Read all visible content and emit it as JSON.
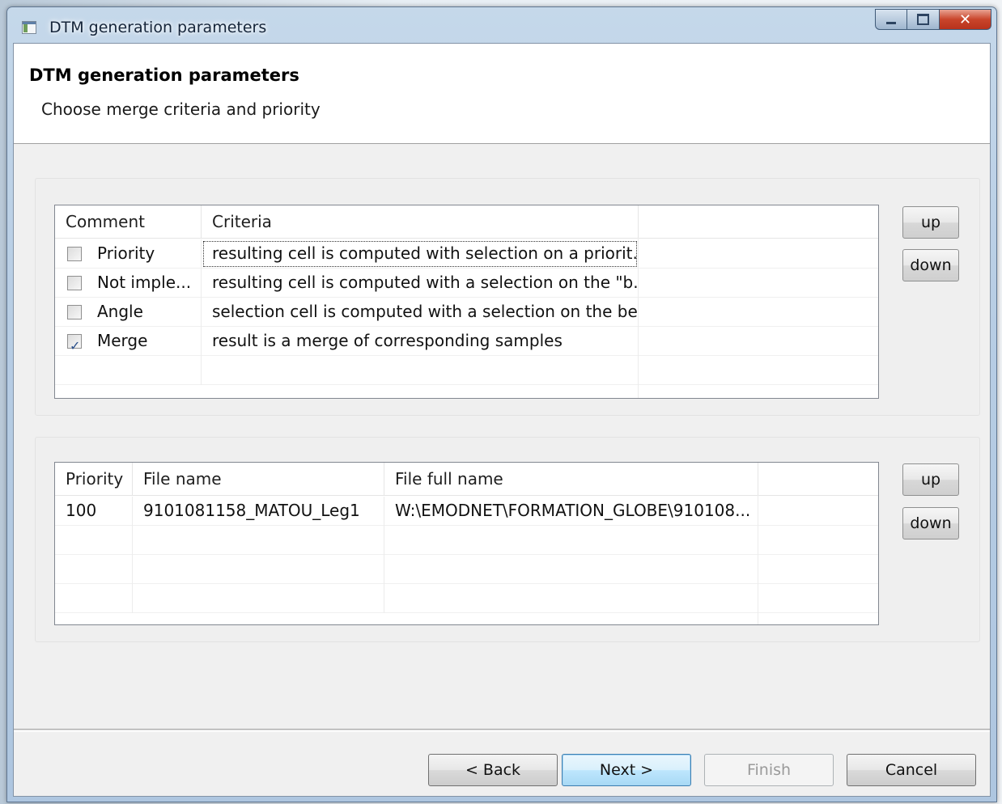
{
  "window": {
    "title": "DTM generation parameters"
  },
  "header": {
    "title": "DTM generation parameters",
    "subtitle": "Choose merge criteria and priority"
  },
  "criteria_table": {
    "columns": [
      "Comment",
      "Criteria",
      ""
    ],
    "rows": [
      {
        "checked": false,
        "comment": "Priority",
        "criteria": "resulting cell is computed with selection on a priorit..."
      },
      {
        "checked": false,
        "comment": "Not imple...",
        "criteria": "resulting cell is computed with a selection on the \"b..."
      },
      {
        "checked": false,
        "comment": "Angle",
        "criteria": "selection cell is computed with a selection on the be..."
      },
      {
        "checked": true,
        "comment": "Merge",
        "criteria": "result is a merge of corresponding samples"
      }
    ],
    "up_label": "up",
    "down_label": "down"
  },
  "files_table": {
    "columns": [
      "Priority",
      "File name",
      "File full name",
      ""
    ],
    "rows": [
      {
        "priority": "100",
        "file_name": "9101081158_MATOU_Leg1",
        "file_full_name": "W:\\EMODNET\\FORMATION_GLOBE\\910108..."
      }
    ],
    "up_label": "up",
    "down_label": "down"
  },
  "footer": {
    "back_label": "< Back",
    "next_label": "Next >",
    "finish_label": "Finish",
    "cancel_label": "Cancel"
  }
}
